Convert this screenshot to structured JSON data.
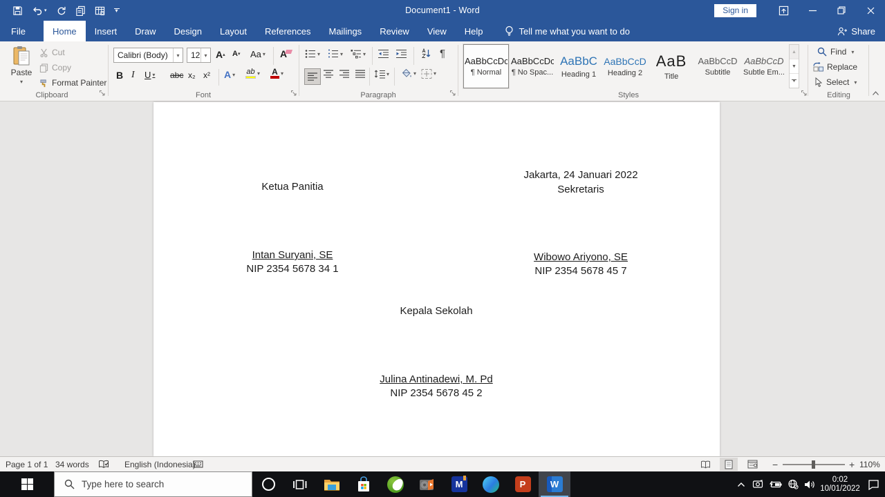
{
  "colors": {
    "accent": "#2b579a",
    "heading_blue": "#2e74b5",
    "taskbar_bg": "#101114",
    "highlight_yellow": "#ffff00",
    "font_color_red": "#c00000"
  },
  "titlebar": {
    "title": "Document1 - Word",
    "sign_in": "Sign in"
  },
  "tabs": {
    "items": [
      "File",
      "Home",
      "Insert",
      "Draw",
      "Design",
      "Layout",
      "References",
      "Mailings",
      "Review",
      "View",
      "Help"
    ],
    "active": "Home",
    "tell_me": "Tell me what you want to do",
    "share": "Share"
  },
  "ribbon": {
    "clipboard": {
      "label": "Clipboard",
      "paste": "Paste",
      "cut": "Cut",
      "copy": "Copy",
      "format_painter": "Format Painter"
    },
    "font": {
      "label": "Font",
      "font_name": "Calibri (Body)",
      "font_size": "12",
      "bold": "B",
      "italic": "I",
      "underline": "U",
      "strikethrough": "abc",
      "subscript": "x₂",
      "superscript": "x²",
      "change_case": "Aa",
      "grow_font": "A",
      "shrink_font": "A",
      "clear_formatting": "A",
      "text_effects": "A",
      "highlight": "ab",
      "font_color": "A"
    },
    "paragraph": {
      "label": "Paragraph",
      "pilcrow": "¶"
    },
    "styles": {
      "label": "Styles",
      "items": [
        {
          "preview": "AaBbCcDc",
          "name": "¶ Normal"
        },
        {
          "preview": "AaBbCcDc",
          "name": "¶ No Spac..."
        },
        {
          "preview": "AaBbC",
          "name": "Heading 1"
        },
        {
          "preview": "AaBbCcD",
          "name": "Heading 2"
        },
        {
          "preview": "AaB",
          "name": "Title"
        },
        {
          "preview": "AaBbCcD",
          "name": "Subtitle"
        },
        {
          "preview": "AaBbCcD",
          "name": "Subtle Em..."
        }
      ]
    },
    "editing": {
      "label": "Editing",
      "find": "Find",
      "replace": "Replace",
      "select": "Select"
    }
  },
  "document": {
    "lines": [
      {
        "text": "Jakarta, 24 Januari 2022"
      },
      {
        "text": "Ketua Panitia"
      },
      {
        "text": "Sekretaris"
      },
      {
        "text": "Intan Suryani, SE"
      },
      {
        "text": "NIP 2354 5678 34 1"
      },
      {
        "text": "Wibowo Ariyono, SE"
      },
      {
        "text": "NIP 2354 5678 45 7"
      },
      {
        "text": "Kepala Sekolah"
      },
      {
        "text": "Julina Antinadewi, M. Pd"
      },
      {
        "text": "NIP 2354 5678 45 2"
      }
    ]
  },
  "statusbar": {
    "page": "Page 1 of 1",
    "words": "34 words",
    "language": "English (Indonesia)",
    "zoom_out": "−",
    "zoom_in": "+",
    "zoom_level": "110%"
  },
  "taskbar": {
    "search_placeholder": "Type here to search",
    "time": "0:02",
    "date": "10/01/2022",
    "m_letter": "M",
    "ppt_letter": "P",
    "word_letter": "W"
  }
}
